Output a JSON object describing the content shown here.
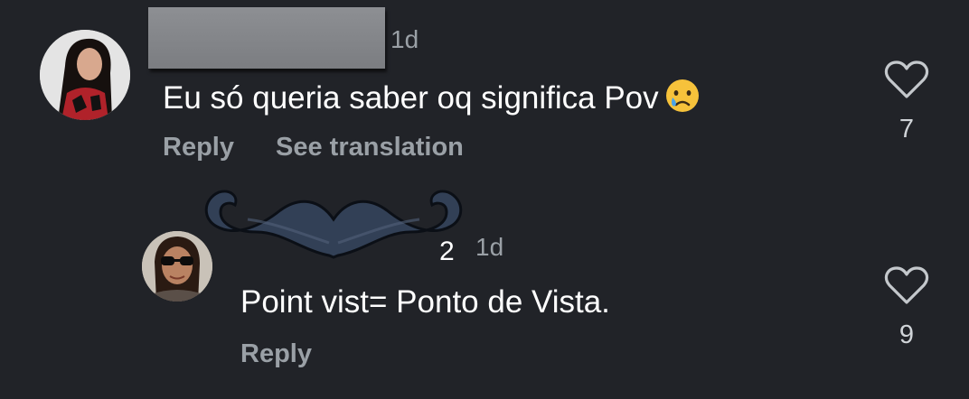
{
  "comments": [
    {
      "time": "1d",
      "text": "Eu só queria saber oq significa Pov",
      "emoji": "crying-face-emoji",
      "actions": {
        "reply": "Reply",
        "translate": "See translation"
      },
      "likes": "7"
    },
    {
      "name_fragment": "2",
      "time": "1d",
      "text": "Point vist= Ponto de Vista.",
      "actions": {
        "reply": "Reply"
      },
      "likes": "9"
    }
  ],
  "icons": {
    "like": "heart-outline-icon",
    "redaction": "mustache-sticker"
  },
  "colors": {
    "background": "#212328",
    "primary_text": "#ffffff",
    "secondary_text": "#9aa0a6",
    "mustache": "#324056"
  }
}
